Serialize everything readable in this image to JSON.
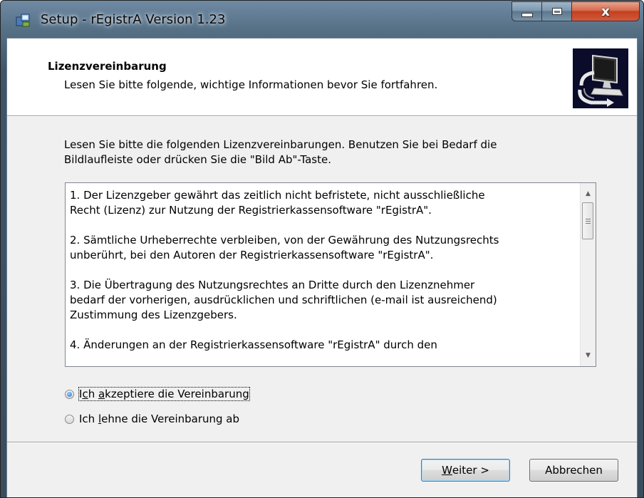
{
  "window": {
    "title": "Setup - rEgistrA Version 1.23",
    "close_glyph": "x"
  },
  "header": {
    "title": "Lizenzvereinbarung",
    "subtitle": "Lesen Sie bitte folgende, wichtige Informationen bevor Sie fortfahren.",
    "image_icon": "setup-computer-icon"
  },
  "intro": {
    "line1": "Lesen Sie bitte die folgenden Lizenzvereinbarungen. Benutzen Sie bei Bedarf die",
    "line2": "Bildlaufleiste oder drücken Sie die \"Bild Ab\"-Taste."
  },
  "license": {
    "p1": [
      "1. Der Lizenzgeber gewährt das zeitlich nicht befristete, nicht ausschließliche",
      "Recht (Lizenz) zur Nutzung der Registrierkassensoftware \"rEgistrA\"."
    ],
    "p2": [
      "2. Sämtliche Urheberrechte verbleiben, von der Gewährung des Nutzungsrechts",
      "unberührt, bei den Autoren der Registrierkassensoftware \"rEgistrA\"."
    ],
    "p3": [
      "3. Die Übertragung des Nutzungsrechtes an Dritte durch den Lizenznehmer",
      "bedarf der vorherigen, ausdrücklichen und schriftlichen (e-mail ist ausreichend)",
      "Zustimmung des Lizenzgebers."
    ],
    "p4": [
      "4. Änderungen an der Registrierkassensoftware \"rEgistrA\" durch den"
    ]
  },
  "options": {
    "accept": {
      "pre": "I",
      "u": "c",
      "mid": "h ",
      "u2": "a",
      "post": "kzeptiere die Vereinbarung",
      "checked": true
    },
    "decline": {
      "pre": "Ich ",
      "u": "l",
      "post": "ehne die Vereinbarung ab",
      "checked": false
    }
  },
  "buttons": {
    "next": {
      "u": "W",
      "rest": "eiter >"
    },
    "cancel": "Abbrechen"
  },
  "colors": {
    "close_button": "#c2401f",
    "default_button_border": "#3c7fb1",
    "radio_fill": "#1e6fbf"
  }
}
